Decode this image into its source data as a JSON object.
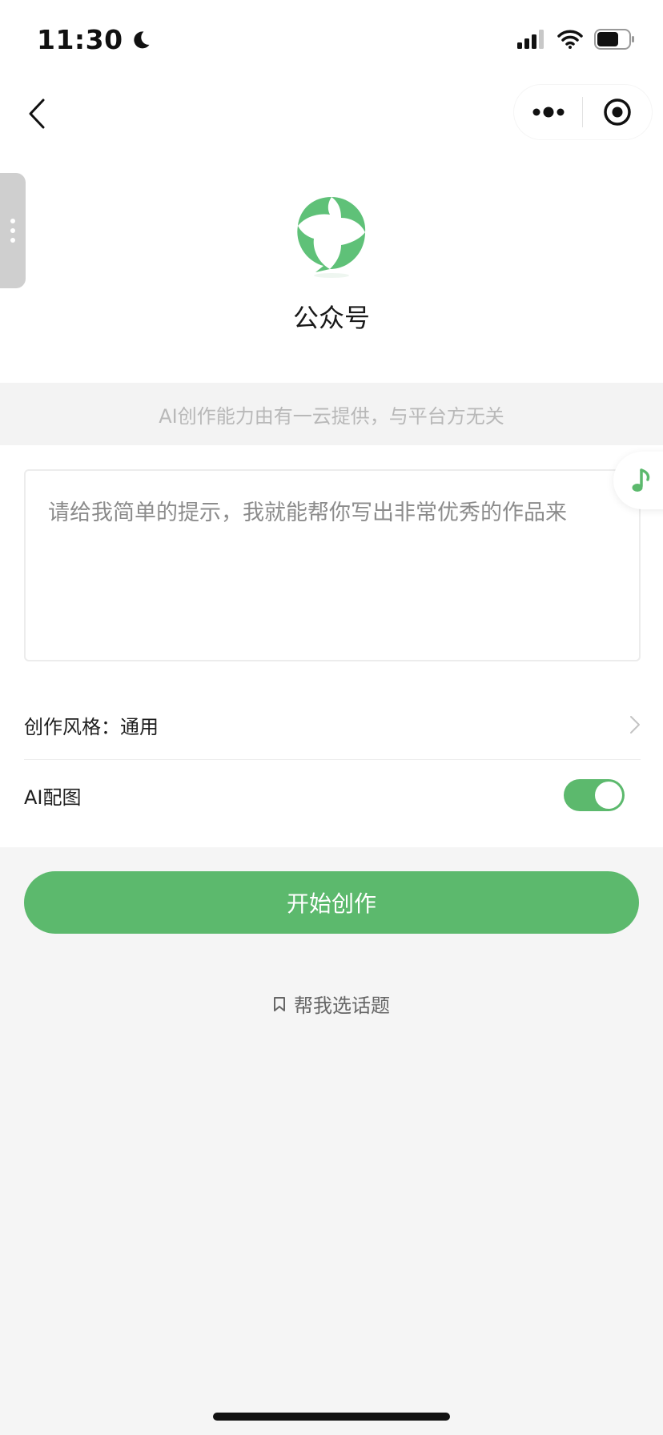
{
  "status_bar": {
    "time": "11:30",
    "icons": [
      "moon-icon",
      "signal-icon",
      "wifi-icon",
      "battery-icon"
    ]
  },
  "nav": {
    "back_icon": "chevron-left-icon",
    "menu_icon": "more-dots-icon",
    "close_icon": "target-icon"
  },
  "header": {
    "logo_icon": "official-account-logo-icon",
    "title": "公众号"
  },
  "notice": "AI创作能力由有一云提供，与平台方无关",
  "form": {
    "prompt_placeholder": "请给我简单的提示，我就能帮你写出非常优秀的作品来",
    "style_label": "创作风格：",
    "style_value": "通用",
    "ai_image_label": "AI配图",
    "ai_image_enabled": true
  },
  "actions": {
    "start_label": "开始创作",
    "topic_label": "帮我选话题"
  },
  "colors": {
    "accent": "#5cb96d",
    "notice_text": "#b8b8b8",
    "background": "#f5f5f5"
  }
}
